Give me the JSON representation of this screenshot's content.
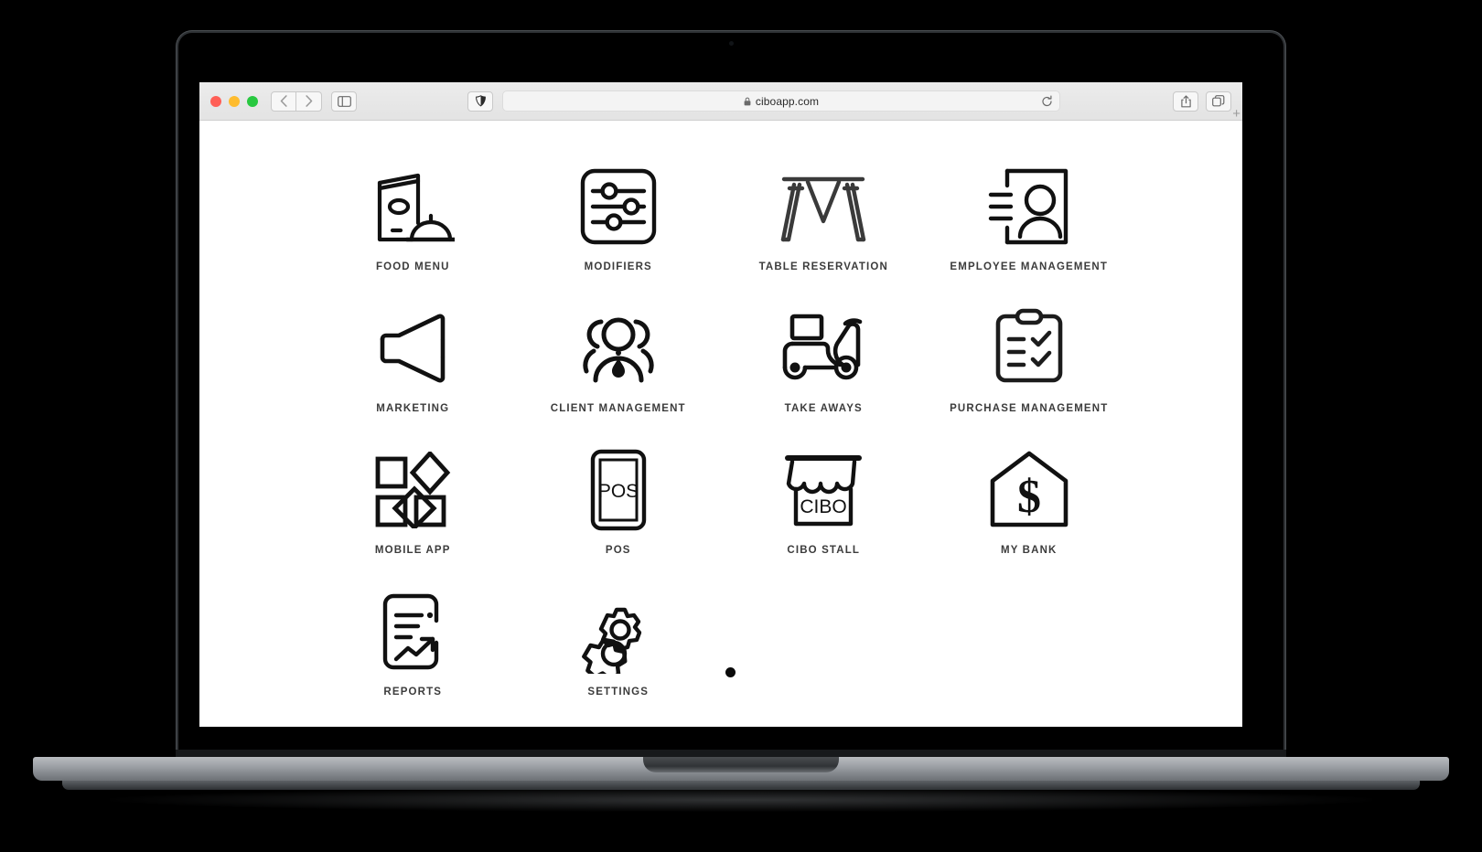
{
  "browser": {
    "traffic_lights": {
      "close": "close",
      "minimize": "minimize",
      "zoom": "zoom"
    },
    "back_label": "‹",
    "forward_label": "›",
    "sidebar_icon": "sidebar-icon",
    "privacy_icon": "privacy-report-icon",
    "lock_icon": "lock-icon",
    "url": "ciboapp.com",
    "reload_icon": "reload-icon",
    "share_icon": "share-icon",
    "tabs_icon": "tab-overview-icon",
    "new_tab_label": "+"
  },
  "page": {
    "apps": [
      {
        "label": "FOOD MENU",
        "icon": "food-menu-icon"
      },
      {
        "label": "MODIFIERS",
        "icon": "modifiers-icon"
      },
      {
        "label": "TABLE RESERVATION",
        "icon": "table-reservation-icon"
      },
      {
        "label": "EMPLOYEE MANAGEMENT",
        "icon": "employee-management-icon"
      },
      {
        "label": "MARKETING",
        "icon": "marketing-megaphone-icon"
      },
      {
        "label": "CLIENT MANAGEMENT",
        "icon": "client-management-icon"
      },
      {
        "label": "TAKE AWAYS",
        "icon": "take-aways-scooter-icon"
      },
      {
        "label": "PURCHASE MANAGEMENT",
        "icon": "purchase-management-clipboard-icon"
      },
      {
        "label": "MOBILE APP",
        "icon": "mobile-app-grid-icon"
      },
      {
        "label": "POS",
        "icon": "pos-device-icon",
        "glyph_text": "POS"
      },
      {
        "label": "CIBO STALL",
        "icon": "cibo-stall-icon",
        "glyph_text": "CIBO"
      },
      {
        "label": "MY BANK",
        "icon": "my-bank-house-dollar-icon",
        "glyph_text": "$"
      },
      {
        "label": "REPORTS",
        "icon": "reports-document-icon"
      },
      {
        "label": "SETTINGS",
        "icon": "settings-gears-icon"
      }
    ]
  },
  "colors": {
    "icon_stroke": "#111111",
    "label_text": "#3c3c3c",
    "page_background": "#ffffff",
    "toolbar_background": "#ececec",
    "traffic_close": "#ff5f57",
    "traffic_minimize": "#febc2e",
    "traffic_zoom": "#28c840"
  }
}
